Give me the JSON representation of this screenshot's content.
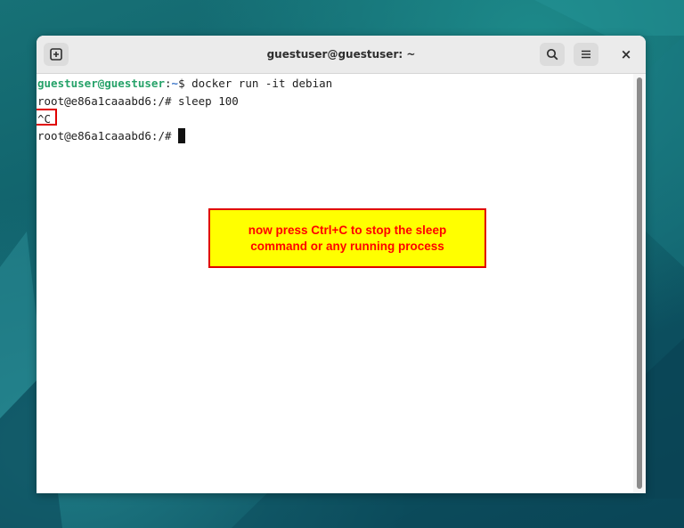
{
  "window": {
    "title": "guestuser@guestuser: ~",
    "new_tab_icon": "new-tab-icon",
    "search_icon": "search-icon",
    "menu_icon": "hamburger-menu-icon",
    "close_icon": "close-icon",
    "close_glyph": "×"
  },
  "terminal": {
    "line1": {
      "user": "guestuser@guestuser",
      "sep": ":",
      "path": "~",
      "cmd": "$ docker run -it debian"
    },
    "line2": "root@e86a1caaabd6:/# sleep 100",
    "line3": "^C",
    "line4": "root@e86a1caaabd6:/# "
  },
  "annotation": {
    "line1": "now press Ctrl+C to stop the sleep",
    "line2": "command or any running process",
    "background": "#ffff00",
    "text_color": "#ff0000",
    "border_color": "#e00000"
  },
  "colors": {
    "prompt_user": "#26a269",
    "prompt_path": "#3d77c9",
    "desktop": "#0e5b66",
    "titlebar": "#ebebeb"
  }
}
